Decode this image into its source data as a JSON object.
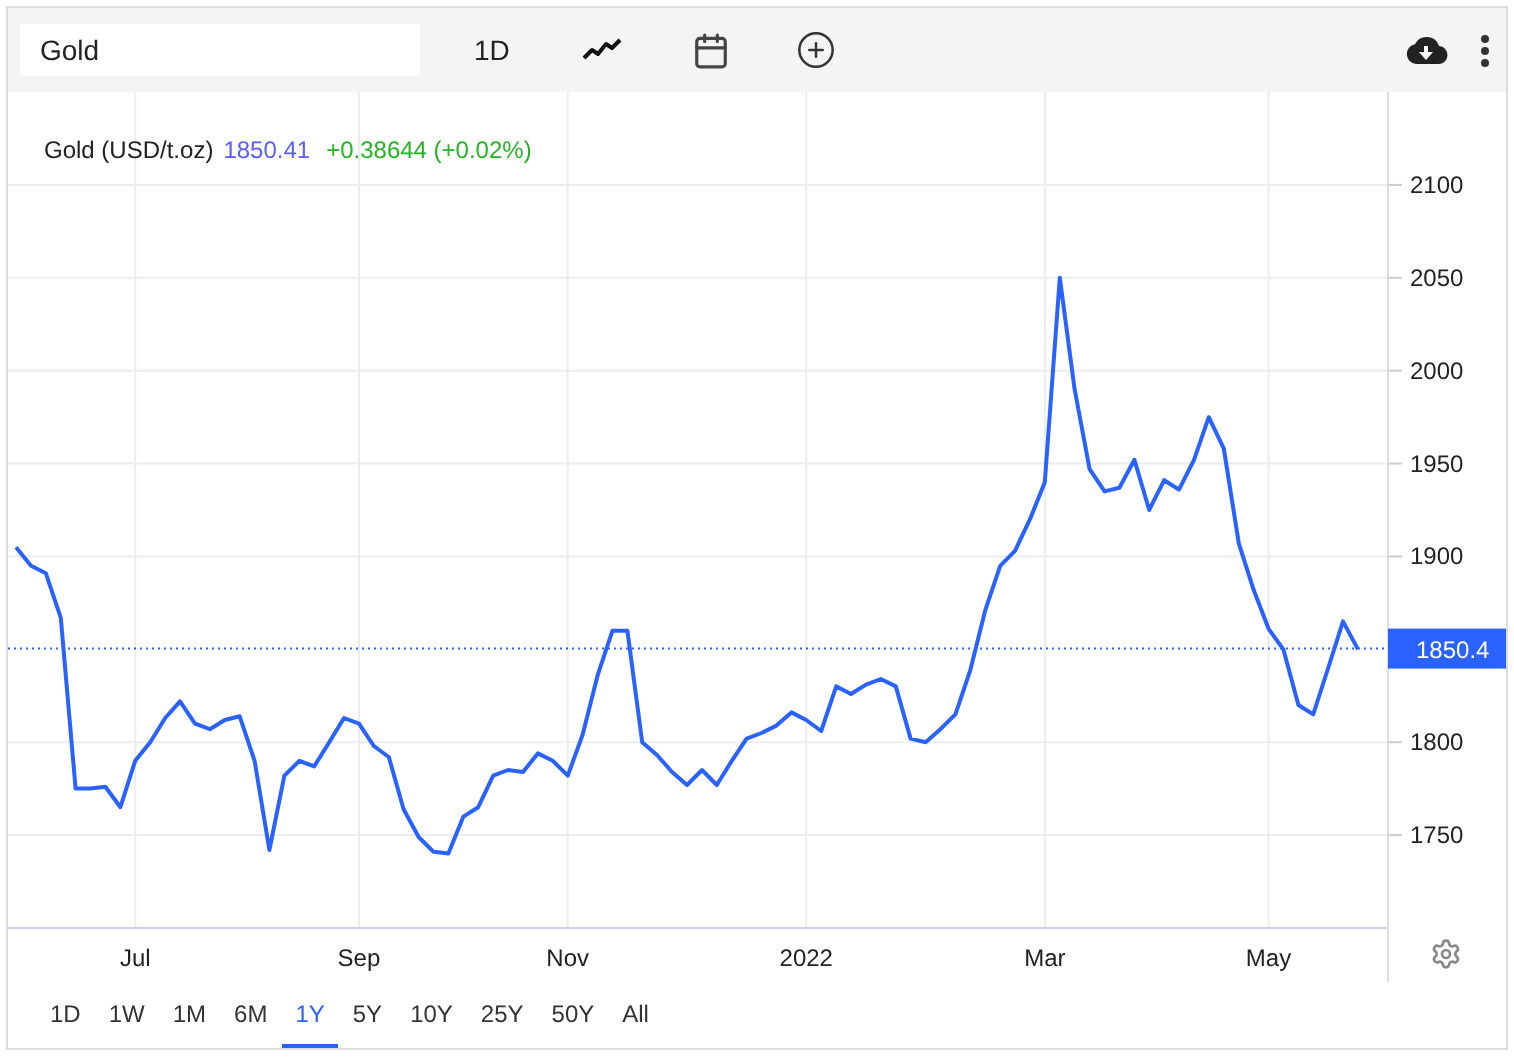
{
  "toolbar": {
    "search": {
      "value": "Gold"
    },
    "interval": "1D"
  },
  "legend": {
    "price": "1850.41",
    "change": "+0.38644 (+0.02%)"
  },
  "price_label": "1850.4",
  "chart_data": {
    "type": "line",
    "categories": [
      null,
      null,
      null,
      null,
      null,
      null,
      null,
      null,
      "Jul",
      null,
      null,
      null,
      null,
      null,
      null,
      null,
      null,
      null,
      null,
      null,
      null,
      null,
      null,
      "Sep",
      null,
      null,
      null,
      null,
      null,
      null,
      null,
      null,
      null,
      null,
      null,
      null,
      null,
      "Nov",
      null,
      null,
      null,
      null,
      null,
      null,
      null,
      null,
      null,
      null,
      null,
      null,
      null,
      null,
      null,
      "2022",
      null,
      null,
      null,
      null,
      null,
      null,
      null,
      null,
      null,
      null,
      null,
      null,
      null,
      null,
      null,
      "Mar",
      null,
      null,
      null,
      null,
      null,
      null,
      null,
      null,
      null,
      null,
      null,
      null,
      null,
      null,
      "May",
      null,
      null,
      null,
      null,
      null,
      null
    ],
    "series": [
      {
        "name": "Gold (USD/t.oz)",
        "color": "#2962ff",
        "values": [
          1905,
          1895,
          1891,
          1867,
          1775,
          1775,
          1776,
          1765,
          1790,
          1800,
          1813,
          1822,
          1810,
          1807,
          1812,
          1814,
          1790,
          1742,
          1782,
          1790,
          1787,
          1800,
          1813,
          1810,
          1798,
          1792,
          1764,
          1749,
          1741,
          1740,
          1760,
          1765,
          1782,
          1785,
          1784,
          1794,
          1790,
          1782,
          1804,
          1836,
          1860,
          1860,
          1800,
          1793,
          1784,
          1777,
          1785,
          1777,
          1790,
          1802,
          1805,
          1809,
          1816,
          1812,
          1806,
          1830,
          1826,
          1831,
          1834,
          1830,
          1802,
          1800,
          1807,
          1815,
          1839,
          1871,
          1895,
          1903,
          1920,
          1940,
          2050,
          1990,
          1947,
          1935,
          1937,
          1952,
          1925,
          1941,
          1936,
          1952,
          1975,
          1958,
          1907,
          1882,
          1861,
          1850,
          1820,
          1815,
          1840,
          1865,
          1850
        ]
      }
    ],
    "ylim": [
      1700,
      2150
    ],
    "grid": true,
    "ref_lines": [
      {
        "axis": "y",
        "value": 1850.4
      }
    ],
    "yticks": [
      1750,
      1800,
      1900,
      1950,
      2000,
      2050,
      2100
    ]
  },
  "ranges": [
    {
      "label": "1D",
      "selected": false
    },
    {
      "label": "1W",
      "selected": false
    },
    {
      "label": "1M",
      "selected": false
    },
    {
      "label": "6M",
      "selected": false
    },
    {
      "label": "1Y",
      "selected": true
    },
    {
      "label": "5Y",
      "selected": false
    },
    {
      "label": "10Y",
      "selected": false
    },
    {
      "label": "25Y",
      "selected": false
    },
    {
      "label": "50Y",
      "selected": false
    },
    {
      "label": "All",
      "selected": false
    }
  ]
}
